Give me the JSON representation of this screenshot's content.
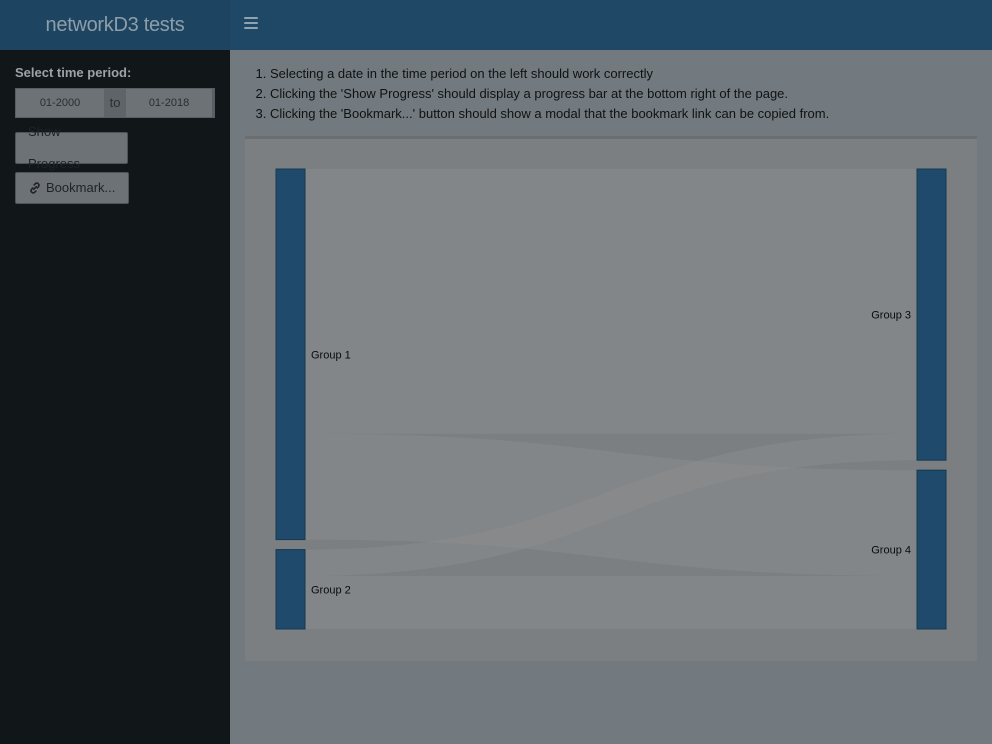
{
  "app": {
    "title": "networkD3 tests"
  },
  "sidebar": {
    "time_period_label": "Select time period:",
    "date_start": "01-2000",
    "date_separator": "to",
    "date_end": "01-2018",
    "progress_button": "Show Progress",
    "bookmark_button": "Bookmark..."
  },
  "main": {
    "instructions": [
      "Selecting a date in the time period on the left should work correctly",
      "Clicking the 'Show Progress' should display a progress bar at the bottom right of the page.",
      "Clicking the 'Bookmark...' button should show a modal that the bookmark link can be copied from."
    ]
  },
  "chart_data": {
    "type": "sankey",
    "nodes": [
      "Group 1",
      "Group 2",
      "Group 3",
      "Group 4"
    ],
    "links": [
      {
        "source": "Group 1",
        "target": "Group 3",
        "value": 50
      },
      {
        "source": "Group 1",
        "target": "Group 4",
        "value": 20
      },
      {
        "source": "Group 2",
        "target": "Group 3",
        "value": 5
      },
      {
        "source": "Group 2",
        "target": "Group 4",
        "value": 10
      }
    ]
  },
  "colors": {
    "node": "#1f4a6c",
    "link": "#8a8c8e",
    "header": "#1e4866",
    "sidebar": "#111619"
  }
}
